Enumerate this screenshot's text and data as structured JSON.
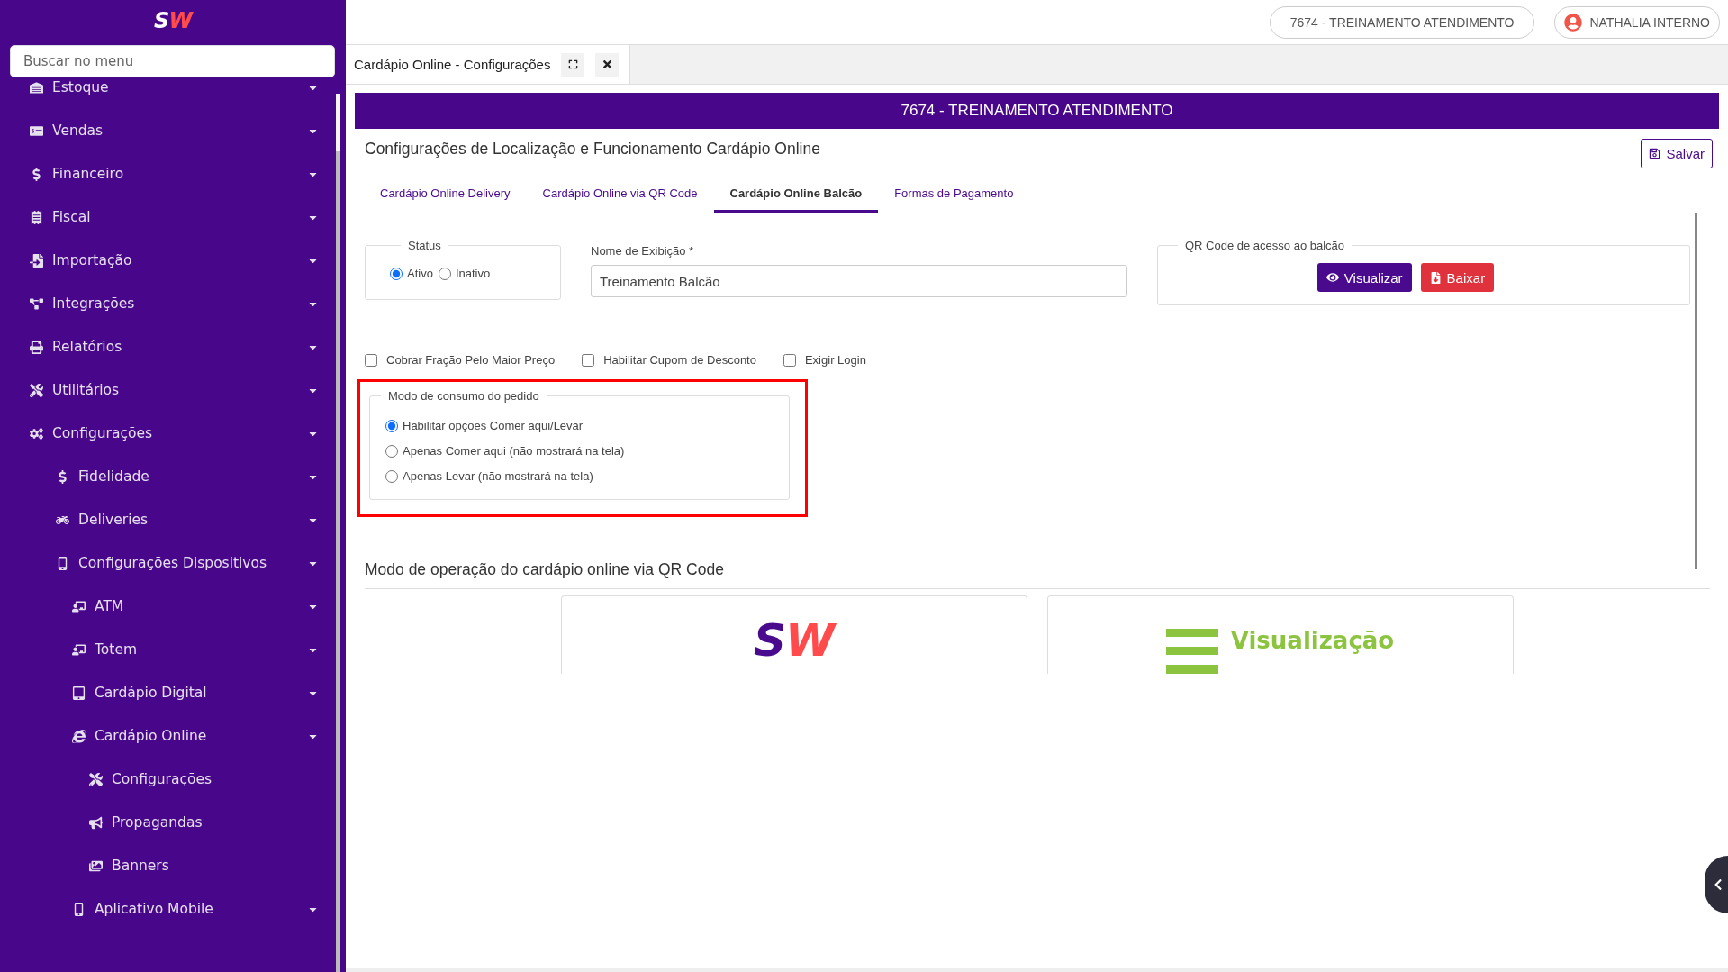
{
  "sidebar": {
    "logo": [
      {
        "text": "S",
        "color": "#ffffff"
      },
      {
        "text": "W",
        "color": "#ff4b4b"
      }
    ],
    "search": {
      "placeholder": "Buscar no menu"
    },
    "items": [
      {
        "label": "Estoque",
        "kind": "group"
      },
      {
        "label": "Vendas",
        "kind": "group"
      },
      {
        "label": "Financeiro",
        "kind": "group"
      },
      {
        "label": "Fiscal",
        "kind": "group"
      },
      {
        "label": "Importação",
        "kind": "group"
      },
      {
        "label": "Integrações",
        "kind": "group"
      },
      {
        "label": "Relatórios",
        "kind": "group"
      },
      {
        "label": "Utilitários",
        "kind": "group"
      },
      {
        "label": "Configurações",
        "kind": "group",
        "children": [
          {
            "label": "Fidelidade",
            "kind": "group"
          },
          {
            "label": "Deliveries",
            "kind": "group"
          },
          {
            "label": "Configurações Dispositivos",
            "kind": "group",
            "children": [
              {
                "label": "ATM",
                "kind": "group"
              },
              {
                "label": "Totem",
                "kind": "group"
              },
              {
                "label": "Cardápio Digital",
                "kind": "group"
              },
              {
                "label": "Cardápio Online",
                "kind": "group",
                "children": [
                  {
                    "label": "Configurações",
                    "kind": "link"
                  },
                  {
                    "label": "Propagandas",
                    "kind": "link"
                  },
                  {
                    "label": "Banners",
                    "kind": "link"
                  }
                ]
              },
              {
                "label": "Aplicativo Mobile",
                "kind": "group"
              }
            ]
          }
        ]
      }
    ]
  },
  "topbar": {
    "company": "7674 - TREINAMENTO ATENDIMENTO",
    "user": "NATHALIA INTERNO"
  },
  "page_tab": {
    "title": "Cardápio Online - Configurações"
  },
  "banner": "7674 - TREINAMENTO ATENDIMENTO",
  "heading": "Configurações de Localização e Funcionamento Cardápio Online",
  "save_button": "Salvar",
  "tabs": [
    {
      "label": "Cardápio Online Delivery",
      "selected": false
    },
    {
      "label": "Cardápio Online via QR Code",
      "selected": false
    },
    {
      "label": "Cardápio Online Balcão",
      "selected": true
    },
    {
      "label": "Formas de Pagamento",
      "selected": false
    }
  ],
  "status": {
    "legend": "Status",
    "options": [
      {
        "label": "Ativo",
        "selected": true
      },
      {
        "label": "Inativo",
        "selected": false
      }
    ]
  },
  "display_name": {
    "label": "Nome de Exibição *",
    "value": "Treinamento Balcão"
  },
  "qr": {
    "legend": "QR Code de acesso ao balcão",
    "view_button": "Visualizar",
    "download_button": "Baixar"
  },
  "checkboxes": [
    {
      "label": "Cobrar Fração Pelo Maior Preço",
      "checked": false
    },
    {
      "label": "Habilitar Cupom de Desconto",
      "checked": false
    },
    {
      "label": "Exigir Login",
      "checked": false
    }
  ],
  "consumption": {
    "legend": "Modo de consumo do pedido",
    "highlighted": true,
    "options": [
      {
        "label": "Habilitar opções Comer aqui/Levar",
        "selected": true
      },
      {
        "label": "Apenas Comer aqui (não mostrará na tela)",
        "selected": false
      },
      {
        "label": "Apenas Levar (não mostrará na tela)",
        "selected": false
      }
    ]
  },
  "operation": {
    "title": "Modo de operação do cardápio online via QR Code",
    "cards": [
      {
        "kind": "logo",
        "letters": [
          {
            "text": "S",
            "color": "#4a0a8e"
          },
          {
            "text": "W",
            "color": "#ff4b4b"
          }
        ]
      },
      {
        "kind": "menu",
        "text": "Visualização"
      }
    ]
  }
}
